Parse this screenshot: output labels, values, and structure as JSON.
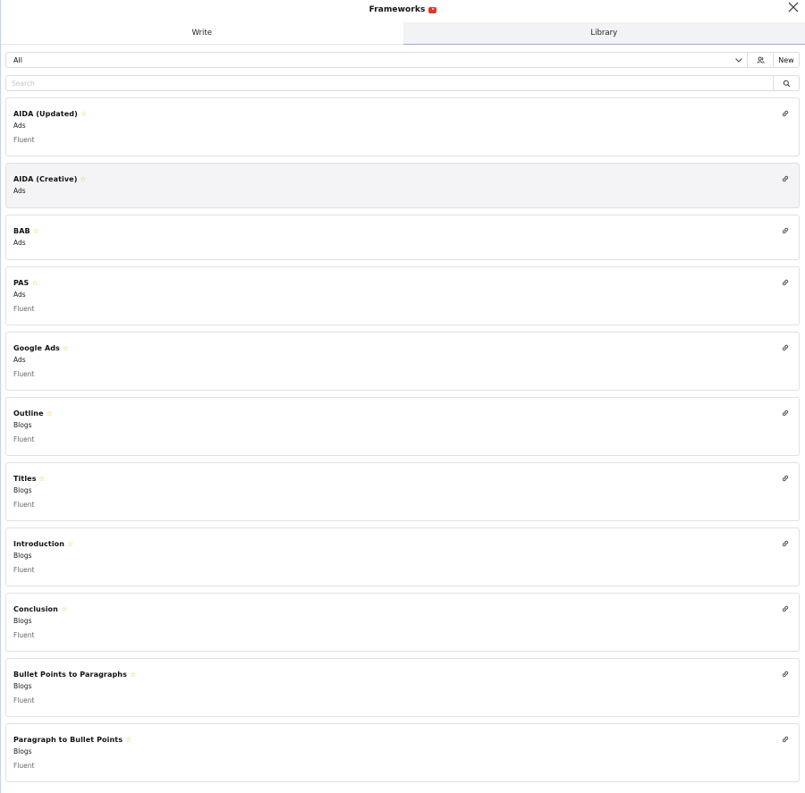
{
  "header": {
    "title": "Frameworks",
    "badge_icon": "youtube-icon",
    "close_icon": "close-icon"
  },
  "tabs": [
    {
      "label": "Write",
      "active": false
    },
    {
      "label": "Library",
      "active": true
    }
  ],
  "filter": {
    "selected": "All",
    "new_label": "New",
    "user_icon": "user-group-icon"
  },
  "search": {
    "placeholder": "Search",
    "value": ""
  },
  "accent_color": "#9aa6f2",
  "star_color": "#f1c232",
  "items": [
    {
      "title": "AIDA (Updated)",
      "category": "Ads",
      "sub": "Fluent"
    },
    {
      "title": "AIDA (Creative)",
      "category": "Ads",
      "sub": ""
    },
    {
      "title": "BAB",
      "category": "Ads",
      "sub": ""
    },
    {
      "title": "PAS",
      "category": "Ads",
      "sub": "Fluent"
    },
    {
      "title": "Google Ads",
      "category": "Ads",
      "sub": "Fluent"
    },
    {
      "title": "Outline",
      "category": "Blogs",
      "sub": "Fluent"
    },
    {
      "title": "Titles",
      "category": "Blogs",
      "sub": "Fluent"
    },
    {
      "title": "Introduction",
      "category": "Blogs",
      "sub": "Fluent"
    },
    {
      "title": "Conclusion",
      "category": "Blogs",
      "sub": "Fluent"
    },
    {
      "title": "Bullet Points to Paragraphs",
      "category": "Blogs",
      "sub": "Fluent"
    },
    {
      "title": "Paragraph to Bullet Points",
      "category": "Blogs",
      "sub": "Fluent"
    }
  ]
}
